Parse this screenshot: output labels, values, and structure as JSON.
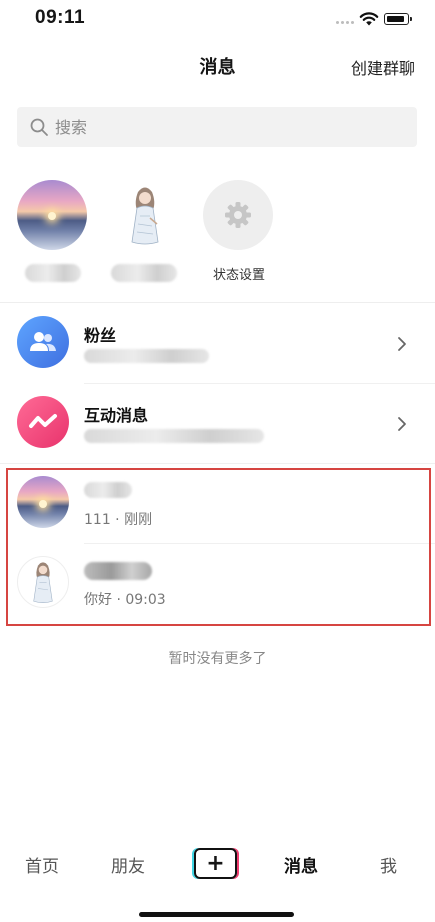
{
  "status_bar": {
    "time": "09:11"
  },
  "header": {
    "title": "消息",
    "create_group": "创建群聊"
  },
  "search": {
    "placeholder": "搜索"
  },
  "stories": [
    {
      "avatar": "sunset-avatar"
    },
    {
      "avatar": "girl-sketch-avatar"
    },
    {
      "label": "状态设置",
      "icon": "gear-icon"
    }
  ],
  "rows": {
    "fans": {
      "title": "粉丝",
      "icon": "people-icon",
      "color": "#4a8df0"
    },
    "interactions": {
      "title": "互动消息",
      "icon": "zigzag-icon",
      "color": "#f0437a"
    }
  },
  "chats": [
    {
      "avatar": "sunset-avatar",
      "preview": "111 · 刚刚"
    },
    {
      "avatar": "girl-sketch-avatar",
      "preview": "你好 · 09:03"
    }
  ],
  "footer_note": "暂时没有更多了",
  "tabbar": {
    "home": "首页",
    "friends": "朋友",
    "plus": "+",
    "messages": "消息",
    "me": "我"
  },
  "colors": {
    "highlight": "#d64541"
  }
}
